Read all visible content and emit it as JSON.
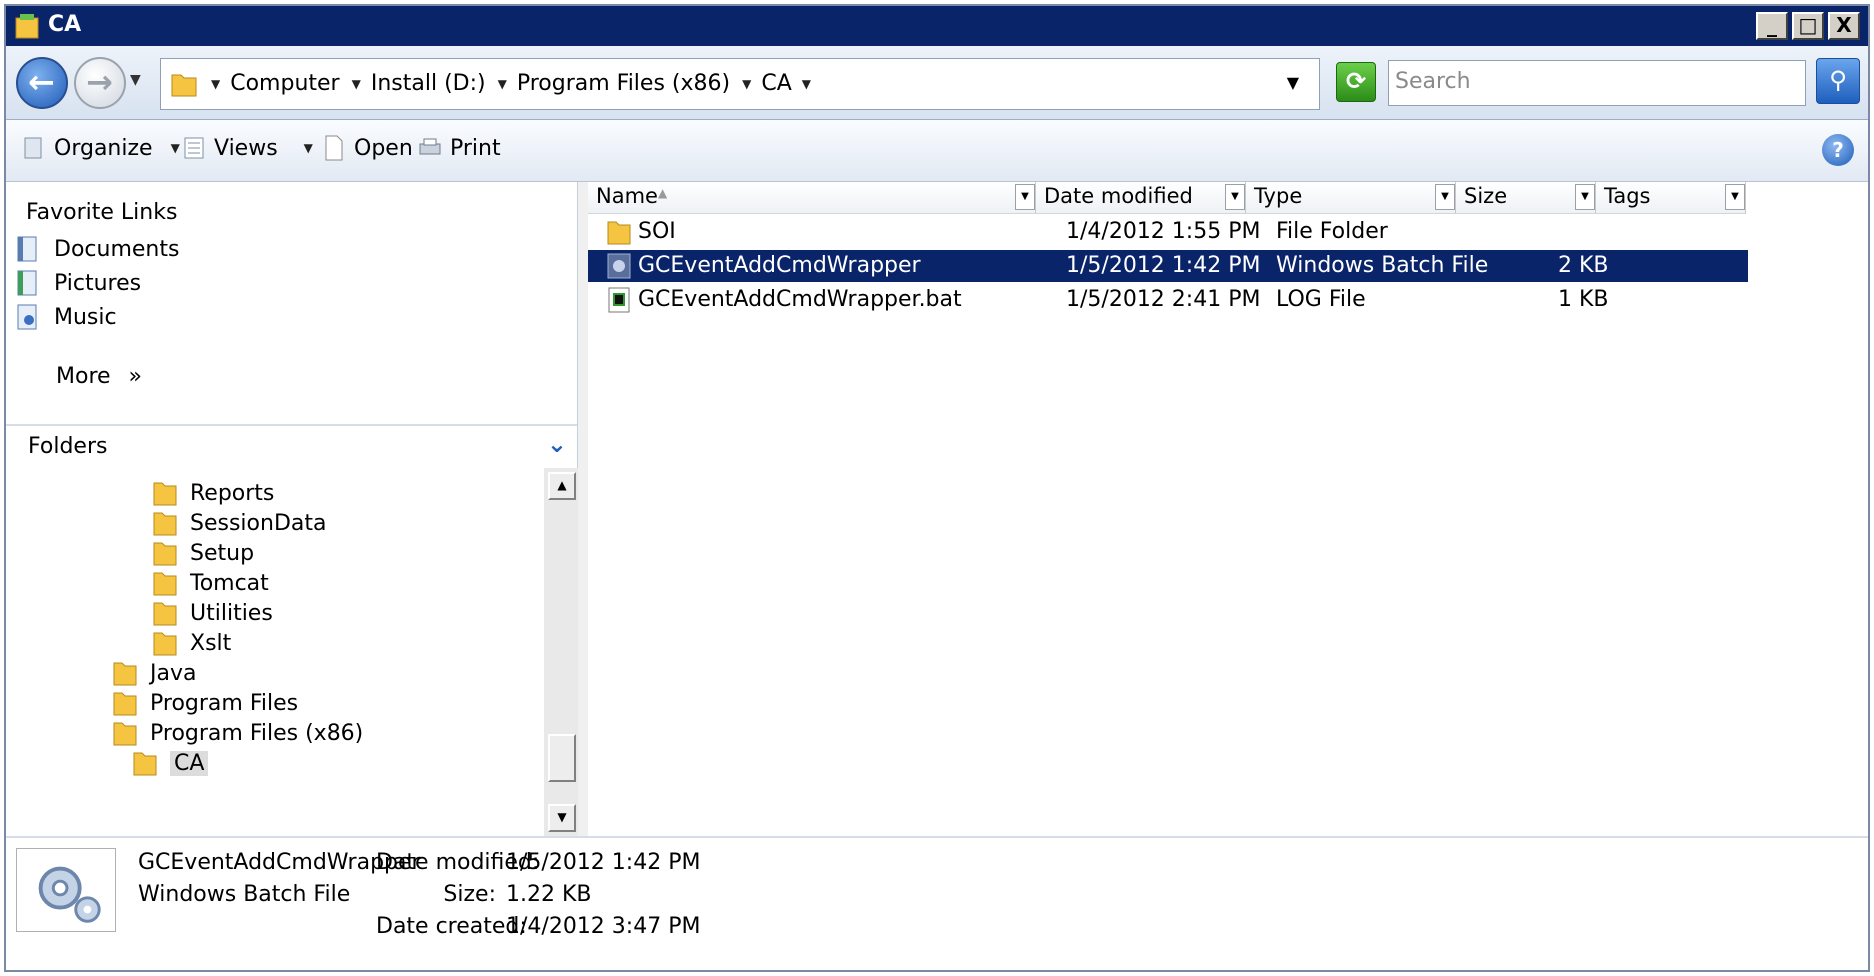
{
  "window": {
    "title": "CA",
    "minimize": "_",
    "maximize": "□",
    "close": "X"
  },
  "address": {
    "crumbs": [
      "Computer",
      "Install (D:)",
      "Program Files (x86)",
      "CA"
    ],
    "search_placeholder": "Search"
  },
  "toolbar": {
    "organize": "Organize",
    "views": "Views",
    "open": "Open",
    "print": "Print",
    "help": "?"
  },
  "favorites": {
    "title": "Favorite Links",
    "items": [
      "Documents",
      "Pictures",
      "Music"
    ],
    "more": "More",
    "more_glyph": "»"
  },
  "folders": {
    "title": "Folders",
    "items": [
      {
        "label": "Reports"
      },
      {
        "label": "SessionData"
      },
      {
        "label": "Setup"
      },
      {
        "label": "Tomcat"
      },
      {
        "label": "Utilities"
      },
      {
        "label": "Xslt"
      },
      {
        "label": "Java"
      },
      {
        "label": "Program Files"
      },
      {
        "label": "Program Files (x86)"
      },
      {
        "label": "CA"
      }
    ]
  },
  "columns": [
    "Name",
    "Date modified",
    "Type",
    "Size",
    "Tags"
  ],
  "files": [
    {
      "name": "SOI",
      "date": "1/4/2012 1:55 PM",
      "type": "File Folder",
      "size": ""
    },
    {
      "name": "GCEventAddCmdWrapper",
      "date": "1/5/2012 1:42 PM",
      "type": "Windows Batch File",
      "size": "2 KB"
    },
    {
      "name": "GCEventAddCmdWrapper.bat",
      "date": "1/5/2012 2:41 PM",
      "type": "LOG File",
      "size": "1 KB"
    }
  ],
  "details": {
    "name": "GCEventAddCmdWrapper",
    "type": "Windows Batch File",
    "date_modified_label": "Date modified:",
    "date_modified": "1/5/2012 1:42 PM",
    "size_label": "Size:",
    "size": "1.22 KB",
    "date_created_label": "Date created:",
    "date_created": "1/4/2012 3:47 PM"
  },
  "colors": {
    "titlebar": "#0a246a",
    "selection": "#0a246a",
    "folder": "#f5c542"
  }
}
